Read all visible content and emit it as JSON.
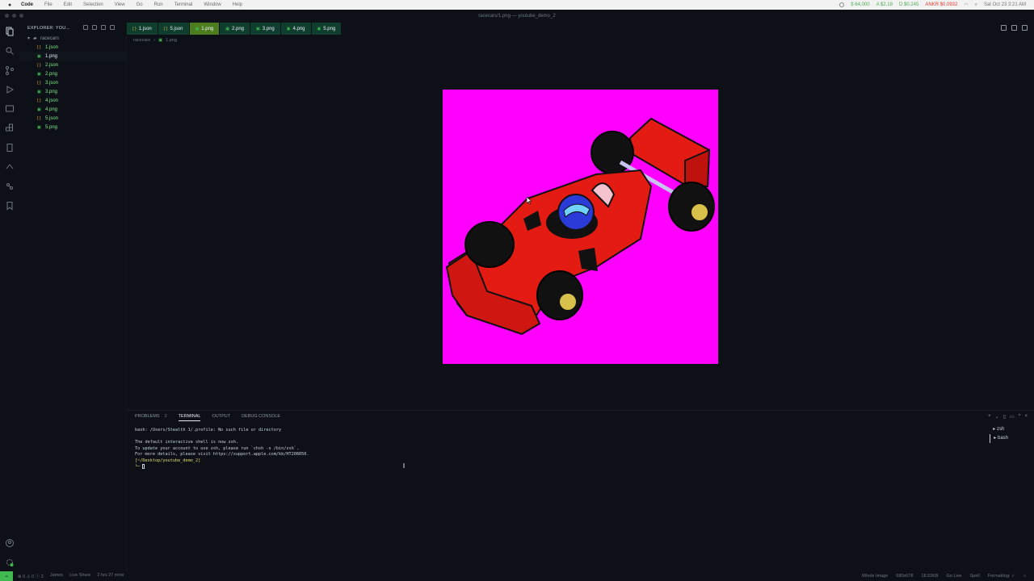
{
  "menubar": {
    "app": "Code",
    "menus": [
      "File",
      "Edit",
      "Selection",
      "View",
      "Go",
      "Run",
      "Terminal",
      "Window",
      "Help"
    ],
    "tickers": [
      "$ 64,000",
      "A $2.18",
      "D $0.245",
      "ANKR $0.0932"
    ],
    "clock": "Sat Oct 23  3:21 AM"
  },
  "window": {
    "title": "racecars/1.png — youtube_demo_2"
  },
  "sidebar": {
    "header": "EXPLORER: YOU...",
    "folder": "racecars",
    "files": [
      {
        "name": "1.json",
        "type": "json"
      },
      {
        "name": "1.png",
        "type": "png"
      },
      {
        "name": "2.json",
        "type": "json"
      },
      {
        "name": "2.png",
        "type": "png"
      },
      {
        "name": "3.json",
        "type": "json"
      },
      {
        "name": "3.png",
        "type": "png"
      },
      {
        "name": "4.json",
        "type": "json"
      },
      {
        "name": "4.png",
        "type": "png"
      },
      {
        "name": "5.json",
        "type": "json"
      },
      {
        "name": "5.png",
        "type": "png"
      }
    ]
  },
  "tabs": [
    {
      "label": "1.json",
      "type": "json"
    },
    {
      "label": "5.json",
      "type": "json"
    },
    {
      "label": "1.png",
      "type": "png"
    },
    {
      "label": "2.png",
      "type": "png"
    },
    {
      "label": "3.png",
      "type": "png"
    },
    {
      "label": "4.png",
      "type": "png"
    },
    {
      "label": "5.png",
      "type": "png"
    }
  ],
  "breadcrumb": {
    "folder": "racecars",
    "file": "1.png"
  },
  "panel": {
    "tabs": [
      "PROBLEMS",
      "TERMINAL",
      "OUTPUT",
      "DEBUG CONSOLE"
    ],
    "problems_count": "2",
    "terminal_lines": [
      "bash: /Users/Stealth 1/.profile: No such file or directory",
      "",
      "The default interactive shell is now zsh.",
      "To update your account to use zsh, please run `chsh -s /bin/zsh`.",
      "For more details, please visit https://support.apple.com/kb/HT208050."
    ],
    "prompt": "[~/Desktop/youtube_demo_2]",
    "shells": [
      "zsh",
      "bash"
    ]
  },
  "statusbar": {
    "left": [
      "⊗ 0 ⚠ 0 ⓘ 2",
      "James",
      "Live Share",
      "2 hrs 27 mins"
    ],
    "right": [
      "Whole Image",
      "680x678",
      "18.92KB",
      "Go Live",
      "Spell",
      "Formatting: ✓"
    ]
  },
  "colors": {
    "accent": "#3fb950",
    "active_tab": "#4d7c1f",
    "tab": "#0f3d2e",
    "image_bg": "#ff00ff"
  }
}
